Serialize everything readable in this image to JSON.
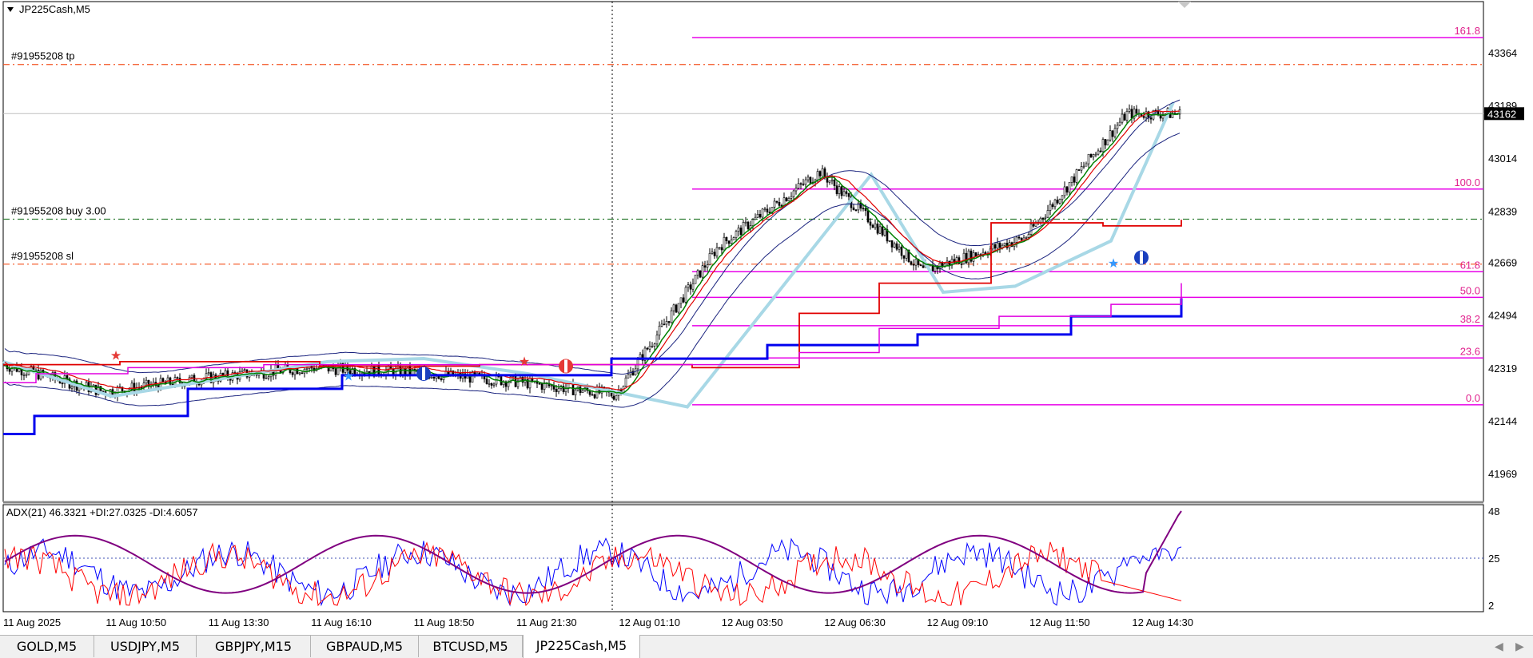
{
  "window": {
    "title": "JP225Cash,M5",
    "collapse_icon": "triangle-down-icon"
  },
  "colors": {
    "bull": "#000000",
    "tp_sl": "#f4511e",
    "entry": "#2e7d32",
    "fib": "#e800e8",
    "fib_text": "#e0208c",
    "price_badge": "#000000",
    "zigzag": "#a8d8e6",
    "ma_red": "#e00000",
    "ma_green": "#008000",
    "ma_magenta": "#e000e0",
    "channel_blue": "#0000ee",
    "bands": "#1a237e",
    "adx": "#800080",
    "plus_di": "#0000ff",
    "minus_di": "#ff0000"
  },
  "main_chart": {
    "symbol_label": "JP225Cash,M5",
    "y_ticks": [
      "43364",
      "43189",
      "43014",
      "42839",
      "42669",
      "42494",
      "42319",
      "42144",
      "41969"
    ],
    "current_price": "43162",
    "y_range": [
      41900,
      43470
    ],
    "trade_labels": {
      "tp": "#91955208 tp",
      "buy": "#91955208 buy 3.00",
      "sl": "#91955208 sl"
    },
    "trade_levels": {
      "tp": 43325,
      "buy": 42812,
      "sl": 42663
    },
    "fib_levels": [
      {
        "label": "161.8",
        "price": 43414
      },
      {
        "label": "100.0",
        "price": 42912
      },
      {
        "label": "61.8",
        "price": 42638
      },
      {
        "label": "50.0",
        "price": 42553
      },
      {
        "label": "38.2",
        "price": 42459
      },
      {
        "label": "23.6",
        "price": 42352
      },
      {
        "label": "0.0",
        "price": 42197
      }
    ]
  },
  "adx_panel": {
    "label": "ADX(21) 46.3321 +DI:27.0325 -DI:4.6057",
    "y_ticks": [
      "48",
      "25",
      "2"
    ],
    "y_range": [
      0,
      50
    ],
    "level": 25
  },
  "x_axis": {
    "labels": [
      "11 Aug 2025",
      "11 Aug 10:50",
      "11 Aug 13:30",
      "11 Aug 16:10",
      "11 Aug 18:50",
      "11 Aug 21:30",
      "12 Aug 01:10",
      "12 Aug 03:50",
      "12 Aug 06:30",
      "12 Aug 09:10",
      "12 Aug 11:50",
      "12 Aug 14:30"
    ]
  },
  "chart_data": {
    "type": "line",
    "title": "JP225Cash,M5",
    "approx_close_by_time": [
      {
        "x": "11 Aug 2025",
        "y": 42330
      },
      {
        "x": "11 Aug 10:50",
        "y": 42240
      },
      {
        "x": "11 Aug 13:30",
        "y": 42285
      },
      {
        "x": "11 Aug 16:10",
        "y": 42320
      },
      {
        "x": "11 Aug 18:50",
        "y": 42305
      },
      {
        "x": "11 Aug 21:30",
        "y": 42275
      },
      {
        "x": "12 Aug 01:10",
        "y": 42230
      },
      {
        "x": "12 Aug 03:50",
        "y": 42720
      },
      {
        "x": "12 Aug 06:30",
        "y": 42970
      },
      {
        "x": "12 Aug 09:10",
        "y": 42640
      },
      {
        "x": "12 Aug 11:50",
        "y": 42750
      },
      {
        "x": "12 Aug 14:30",
        "y": 43162
      }
    ],
    "indicator": {
      "name": "ADX(21)",
      "adx": 46.3321,
      "plus_di": 27.0325,
      "minus_di": 4.6057
    }
  },
  "tabs": [
    {
      "label": "GOLD,M5",
      "active": false
    },
    {
      "label": "USDJPY,M5",
      "active": false
    },
    {
      "label": "GBPJPY,M15",
      "active": false
    },
    {
      "label": "GBPAUD,M5",
      "active": false
    },
    {
      "label": "BTCUSD,M5",
      "active": false
    },
    {
      "label": "JP225Cash,M5",
      "active": true
    }
  ],
  "tab_scroll": {
    "left_icon": "arrow-left-icon",
    "right_icon": "arrow-right-icon",
    "left_glyph": "◀",
    "right_glyph": "▶"
  }
}
